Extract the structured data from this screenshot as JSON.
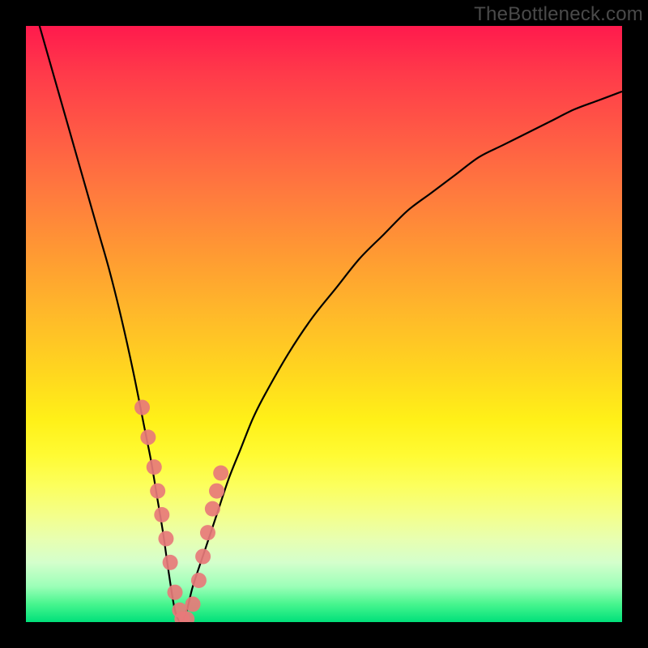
{
  "watermark": "TheBottleneck.com",
  "colors": {
    "frame": "#000000",
    "curve": "#000000",
    "marker_fill": "#e77a7a",
    "marker_stroke": "#d66",
    "gradient_top": "#ff1a4d",
    "gradient_bottom": "#00e07a"
  },
  "chart_data": {
    "type": "line",
    "title": "",
    "xlabel": "",
    "ylabel": "",
    "xlim": [
      0,
      100
    ],
    "ylim": [
      0,
      100
    ],
    "grid": false,
    "legend": false,
    "x": [
      0,
      2,
      4,
      6,
      8,
      10,
      12,
      14,
      16,
      18,
      20,
      21,
      22,
      23,
      24,
      25,
      26,
      27,
      28,
      30,
      32,
      34,
      36,
      38,
      40,
      44,
      48,
      52,
      56,
      60,
      64,
      68,
      72,
      76,
      80,
      84,
      88,
      92,
      96,
      100
    ],
    "values": [
      108,
      101,
      94,
      87,
      80,
      73,
      66,
      59,
      51,
      42,
      32,
      27,
      21,
      15,
      8,
      2,
      0,
      2,
      6,
      12,
      18,
      24,
      29,
      34,
      38,
      45,
      51,
      56,
      61,
      65,
      69,
      72,
      75,
      78,
      80,
      82,
      84,
      86,
      87.5,
      89
    ],
    "markers": {
      "x": [
        19.5,
        20.5,
        21.5,
        22.1,
        22.8,
        23.5,
        24.2,
        25.0,
        25.8,
        26.2,
        27.0,
        28.0,
        29.0,
        29.7,
        30.5,
        31.3,
        32.0,
        32.7
      ],
      "y": [
        36,
        31,
        26,
        22,
        18,
        14,
        10,
        5,
        2,
        0.5,
        0.5,
        3,
        7,
        11,
        15,
        19,
        22,
        25
      ]
    }
  }
}
